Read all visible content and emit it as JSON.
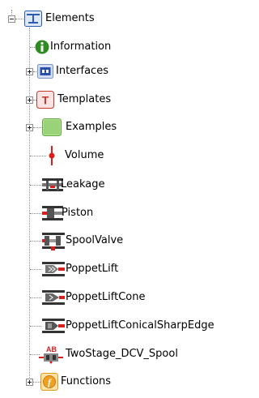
{
  "tree": {
    "root": {
      "label": "Elements",
      "icon": "elements-table-icon",
      "expanded": true
    },
    "children": [
      {
        "label": "Information",
        "icon": "info-icon",
        "expandable": false
      },
      {
        "label": "Interfaces",
        "icon": "interfaces-icon",
        "expandable": true,
        "expanded": false
      },
      {
        "label": "Templates",
        "icon": "templates-icon",
        "expandable": true,
        "expanded": false
      },
      {
        "label": "Examples",
        "icon": "examples-icon",
        "expandable": true,
        "expanded": false
      },
      {
        "label": "Volume",
        "icon": "volume-icon",
        "expandable": false
      },
      {
        "label": "Leakage",
        "icon": "leakage-icon",
        "expandable": false
      },
      {
        "label": "Piston",
        "icon": "piston-icon",
        "expandable": false
      },
      {
        "label": "SpoolValve",
        "icon": "spoolvalve-icon",
        "expandable": false
      },
      {
        "label": "PoppetLift",
        "icon": "poppetlift-icon",
        "expandable": false
      },
      {
        "label": "PoppetLiftCone",
        "icon": "poppetliftcone-icon",
        "expandable": false
      },
      {
        "label": "PoppetLiftConicalSharpEdge",
        "icon": "poppetliftconicalsharpedge-icon",
        "expandable": false
      },
      {
        "label": "TwoStage_DCV_Spool",
        "icon": "twostage-dcv-spool-icon",
        "expandable": false
      },
      {
        "label": "Functions",
        "icon": "functions-icon",
        "expandable": true,
        "expanded": false
      }
    ]
  },
  "colors": {
    "connector": "#8a8a8a",
    "elements_blue": "#2a5db0",
    "info_green": "#2e8b22",
    "templates_red": "#c0392b",
    "examples_green": "#9ad27a",
    "functions_orange": "#f0a020",
    "volume_red": "#d62020"
  }
}
